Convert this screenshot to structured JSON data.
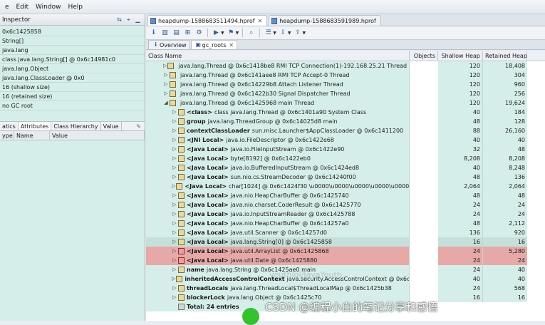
{
  "menu": [
    "e",
    "Edit",
    "Window",
    "Help"
  ],
  "inspector": {
    "title": "Inspector",
    "lines": [
      "0x6c1425858",
      "String[]",
      "java.lang",
      "class java.lang.String[] @ 0x6c14981c0",
      "java.lang.Object",
      "java.lang.ClassLoader @ 0x0",
      "16 (shallow size)",
      "16 (retained size)",
      "no GC root"
    ],
    "tabs": [
      "atics",
      "Attributes",
      "Class Hierarchy",
      "Value"
    ],
    "columns": [
      "ype",
      "Name",
      "Value"
    ]
  },
  "editor_tabs": [
    {
      "label": "heapdump-1588683511494.hprof",
      "active": true
    },
    {
      "label": "heapdump-1588683591989.hprof",
      "active": false
    }
  ],
  "view_tabs": [
    {
      "label": "Overview",
      "active": false
    },
    {
      "label": "gc_roots",
      "active": true
    }
  ],
  "table": {
    "headers": {
      "name": "Class Name",
      "objects": "Objects",
      "shallow": "Shallow Heap",
      "retained": "Retained Heap"
    },
    "rows": [
      {
        "indent": 1,
        "twisty": "▷",
        "icon": "thread",
        "label": "",
        "text": "java.lang.Thread @ 0x6c1418be8  RMI TCP Connection(1)-192.168.25.21 Thread",
        "objects": "",
        "shallow": "120",
        "retained": "18,408",
        "style": ""
      },
      {
        "indent": 1,
        "twisty": "▷",
        "icon": "thread",
        "label": "",
        "text": "java.lang.Thread @ 0x6c141aee8  RMI TCP Accept-0 Thread",
        "objects": "",
        "shallow": "120",
        "retained": "304",
        "style": ""
      },
      {
        "indent": 1,
        "twisty": "▷",
        "icon": "thread",
        "label": "",
        "text": "java.lang.Thread @ 0x6c14229b8  Attach Listener Thread",
        "objects": "",
        "shallow": "120",
        "retained": "960",
        "style": ""
      },
      {
        "indent": 1,
        "twisty": "▷",
        "icon": "thread",
        "label": "",
        "text": "java.lang.Thread @ 0x6c1422b30  Signal Dispatcher Thread",
        "objects": "",
        "shallow": "120",
        "retained": "256",
        "style": ""
      },
      {
        "indent": 1,
        "twisty": "◢",
        "icon": "thread",
        "label": "",
        "text": "java.lang.Thread @ 0x6c1425968  main Thread",
        "objects": "",
        "shallow": "120",
        "retained": "19,624",
        "style": ""
      },
      {
        "indent": 2,
        "twisty": "▷",
        "icon": "obj",
        "label": "<class>",
        "text": "class java.lang.Thread @ 0x6c1401a90 System Class",
        "objects": "",
        "shallow": "40",
        "retained": "184",
        "style": ""
      },
      {
        "indent": 2,
        "twisty": "▷",
        "icon": "obj",
        "label": "group",
        "text": "java.lang.ThreadGroup @ 0x6c14025d8  main",
        "objects": "",
        "shallow": "48",
        "retained": "128",
        "style": ""
      },
      {
        "indent": 2,
        "twisty": "▷",
        "icon": "obj",
        "label": "contextClassLoader",
        "text": "sun.misc.Launcher$AppClassLoader @ 0x6c1411200",
        "objects": "",
        "shallow": "88",
        "retained": "26,160",
        "style": ""
      },
      {
        "indent": 2,
        "twisty": "▷",
        "icon": "obj",
        "label": "<JNI Local>",
        "text": "java.io.FileDescriptor @ 0x6c1422e68",
        "objects": "",
        "shallow": "40",
        "retained": "40",
        "style": ""
      },
      {
        "indent": 2,
        "twisty": "▷",
        "icon": "obj",
        "label": "<Java Local>",
        "text": "java.io.FileInputStream @ 0x6c1422e90",
        "objects": "",
        "shallow": "32",
        "retained": "48",
        "style": ""
      },
      {
        "indent": 2,
        "twisty": "▷",
        "icon": "obj",
        "label": "<Java Local>",
        "text": "byte[8192] @ 0x6c1422eb0",
        "objects": "",
        "shallow": "8,208",
        "retained": "8,208",
        "style": ""
      },
      {
        "indent": 2,
        "twisty": "▷",
        "icon": "obj",
        "label": "<Java Local>",
        "text": "java.io.BufferedInputStream @ 0x6c1424ed8",
        "objects": "",
        "shallow": "40",
        "retained": "8,248",
        "style": ""
      },
      {
        "indent": 2,
        "twisty": "▷",
        "icon": "obj",
        "label": "<Java Local>",
        "text": "sun.nio.cs.StreamDecoder @ 0x6c14240f00",
        "objects": "",
        "shallow": "48",
        "retained": "136",
        "style": ""
      },
      {
        "indent": 2,
        "twisty": "▷",
        "icon": "obj",
        "label": "<Java Local>",
        "text": "char[1024] @ 0x6c1424f30  \\u0000\\u0000\\u0000\\u0000\\u0000",
        "objects": "",
        "shallow": "2,064",
        "retained": "2,064",
        "style": ""
      },
      {
        "indent": 2,
        "twisty": "▷",
        "icon": "obj",
        "label": "<Java Local>",
        "text": "java.nio.HeapCharBuffer @ 0x6c1425740",
        "objects": "",
        "shallow": "48",
        "retained": "48",
        "style": ""
      },
      {
        "indent": 2,
        "twisty": "▷",
        "icon": "obj",
        "label": "<Java Local>",
        "text": "java.nio.charset.CoderResult @ 0x6c1425770",
        "objects": "",
        "shallow": "24",
        "retained": "24",
        "style": ""
      },
      {
        "indent": 2,
        "twisty": "▷",
        "icon": "obj",
        "label": "<Java Local>",
        "text": "java.io.InputStreamReader @ 0x6c1425788",
        "objects": "",
        "shallow": "24",
        "retained": "24",
        "style": ""
      },
      {
        "indent": 2,
        "twisty": "▷",
        "icon": "obj",
        "label": "<Java Local>",
        "text": "java.nio.HeapCharBuffer @ 0x6c14257a0",
        "objects": "",
        "shallow": "48",
        "retained": "2,112",
        "style": ""
      },
      {
        "indent": 2,
        "twisty": "▷",
        "icon": "obj",
        "label": "<Java Local>",
        "text": "java.util.Scanner @ 0x6c14257d0",
        "objects": "",
        "shallow": "136",
        "retained": "920",
        "style": ""
      },
      {
        "indent": 2,
        "twisty": "▷",
        "icon": "obj",
        "label": "<Java Local>",
        "text": "java.lang.String[0] @ 0x6c1425858",
        "objects": "",
        "shallow": "16",
        "retained": "16",
        "style": "sel"
      },
      {
        "indent": 2,
        "twisty": "▷",
        "icon": "red",
        "label": "<Java Local>",
        "text": "java.util.ArrayList @ 0x6c1425868",
        "objects": "",
        "shallow": "24",
        "retained": "5,280",
        "style": "hl"
      },
      {
        "indent": 2,
        "twisty": "▷",
        "icon": "red",
        "label": "<Java Local>",
        "text": "java.util.Date @ 0x6c1425880",
        "objects": "",
        "shallow": "24",
        "retained": "24",
        "style": "hl"
      },
      {
        "indent": 2,
        "twisty": "▷",
        "icon": "obj",
        "label": "name",
        "text": "java.lang.String @ 0x6c1425ae0  main",
        "objects": "",
        "shallow": "24",
        "retained": "40",
        "style": ""
      },
      {
        "indent": 2,
        "twisty": "▷",
        "icon": "obj",
        "label": "inheritedAccessControlContext",
        "text": "java.security.AccessControlContext @ 0x6c1",
        "objects": "",
        "shallow": "40",
        "retained": "40",
        "style": ""
      },
      {
        "indent": 2,
        "twisty": "▷",
        "icon": "obj",
        "label": "threadLocals",
        "text": "java.lang.ThreadLocal$ThreadLocalMap @ 0x6c1425b38",
        "objects": "",
        "shallow": "24",
        "retained": "568",
        "style": ""
      },
      {
        "indent": 2,
        "twisty": "▷",
        "icon": "obj",
        "label": "blockerLock",
        "text": "java.lang.Object @ 0x6c1425c70",
        "objects": "",
        "shallow": "16",
        "retained": "16",
        "style": ""
      },
      {
        "indent": 2,
        "twisty": "",
        "icon": "sum",
        "label": "Total: 24 entries",
        "text": "",
        "objects": "",
        "shallow": "",
        "retained": "",
        "style": ""
      }
    ]
  },
  "overlay": {
    "watermark": "CSDN @编程小白的笔记分享和感悟",
    "url_watermark": "youthlgl/JavaYouth"
  }
}
